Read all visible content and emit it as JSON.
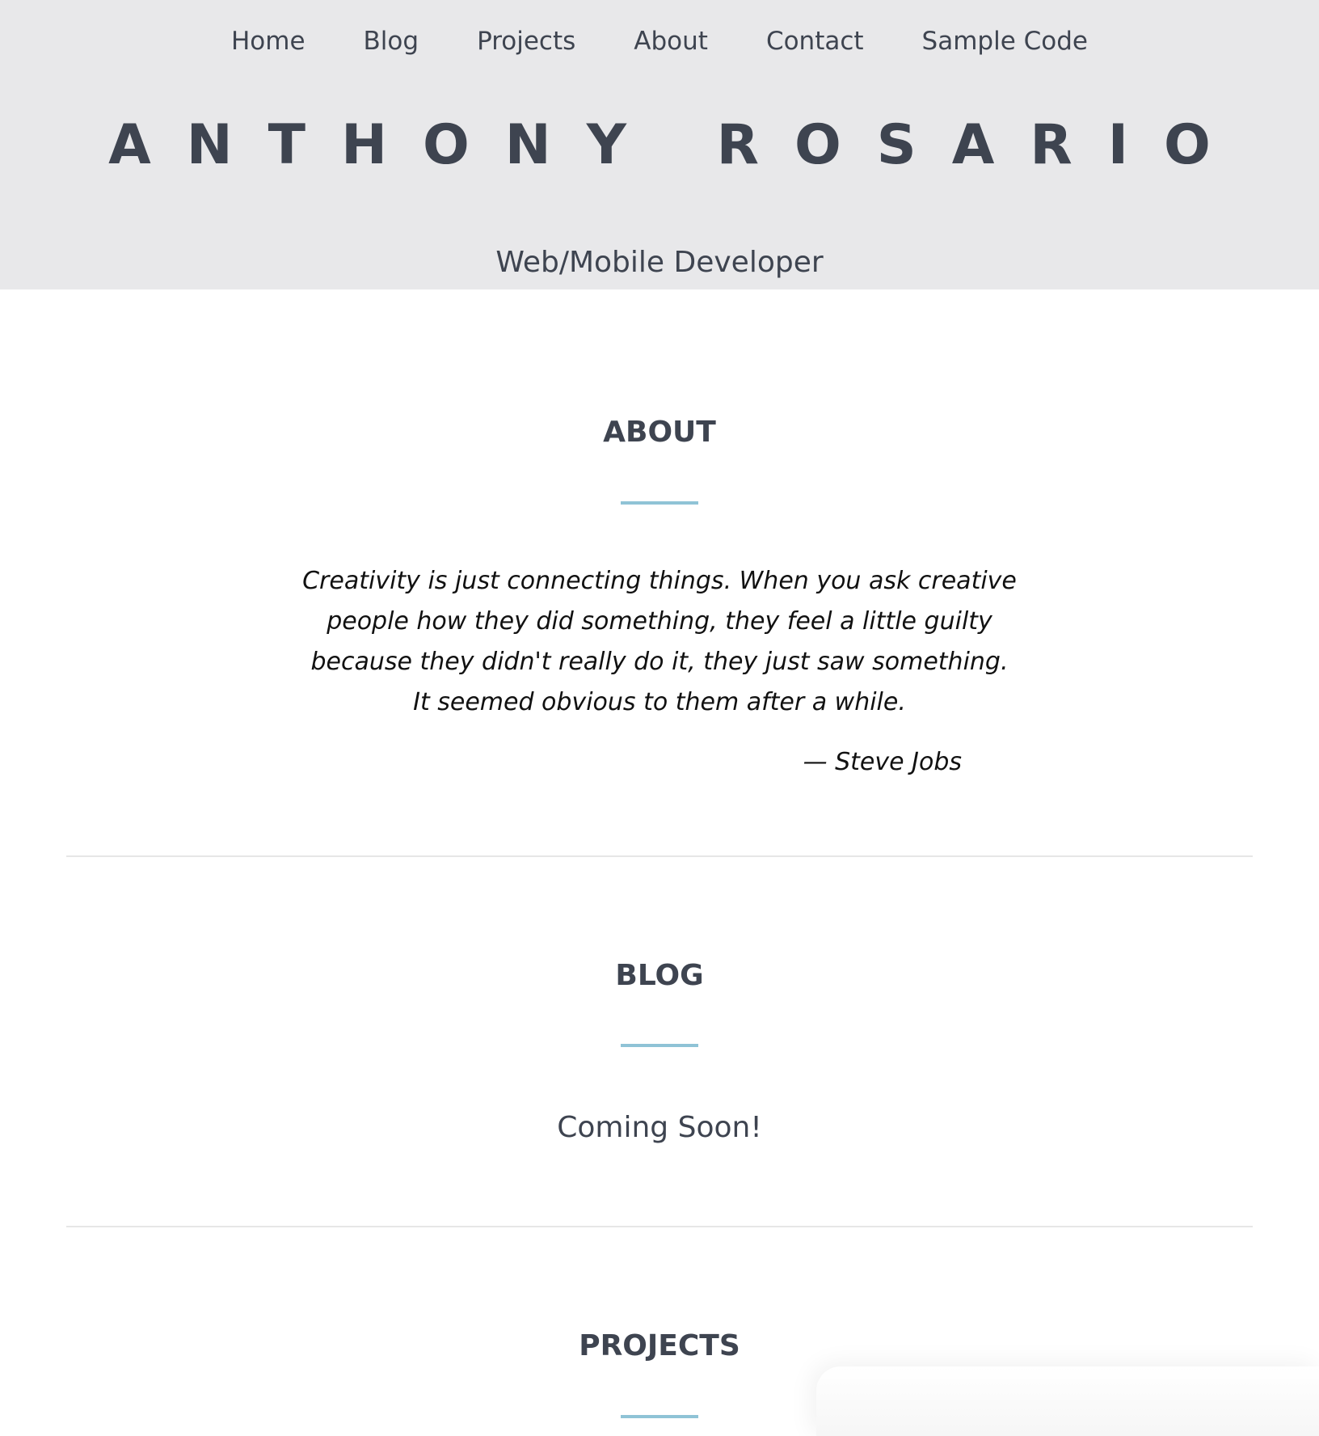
{
  "nav": {
    "items": [
      {
        "label": "Home"
      },
      {
        "label": "Blog"
      },
      {
        "label": "Projects"
      },
      {
        "label": "About"
      },
      {
        "label": "Contact"
      },
      {
        "label": "Sample Code"
      }
    ]
  },
  "header": {
    "title": "ANTHONY ROSARIO",
    "subtitle": "Web/Mobile Developer"
  },
  "about": {
    "heading": "ABOUT",
    "quote_lines": [
      "Creativity is just connecting things. When you ask creative",
      "people how they did something, they feel a little guilty",
      "because they didn't really do it, they just saw something.",
      "It seemed obvious to them after a while."
    ],
    "author": "— Steve Jobs"
  },
  "blog": {
    "heading": "BLOG",
    "body": "Coming Soon!"
  },
  "projects": {
    "heading": "PROJECTS"
  },
  "colors": {
    "header_bg": "#e8e8ea",
    "text": "#3e4450",
    "accent": "#8fc3d6",
    "divider": "#e6e6e6"
  }
}
